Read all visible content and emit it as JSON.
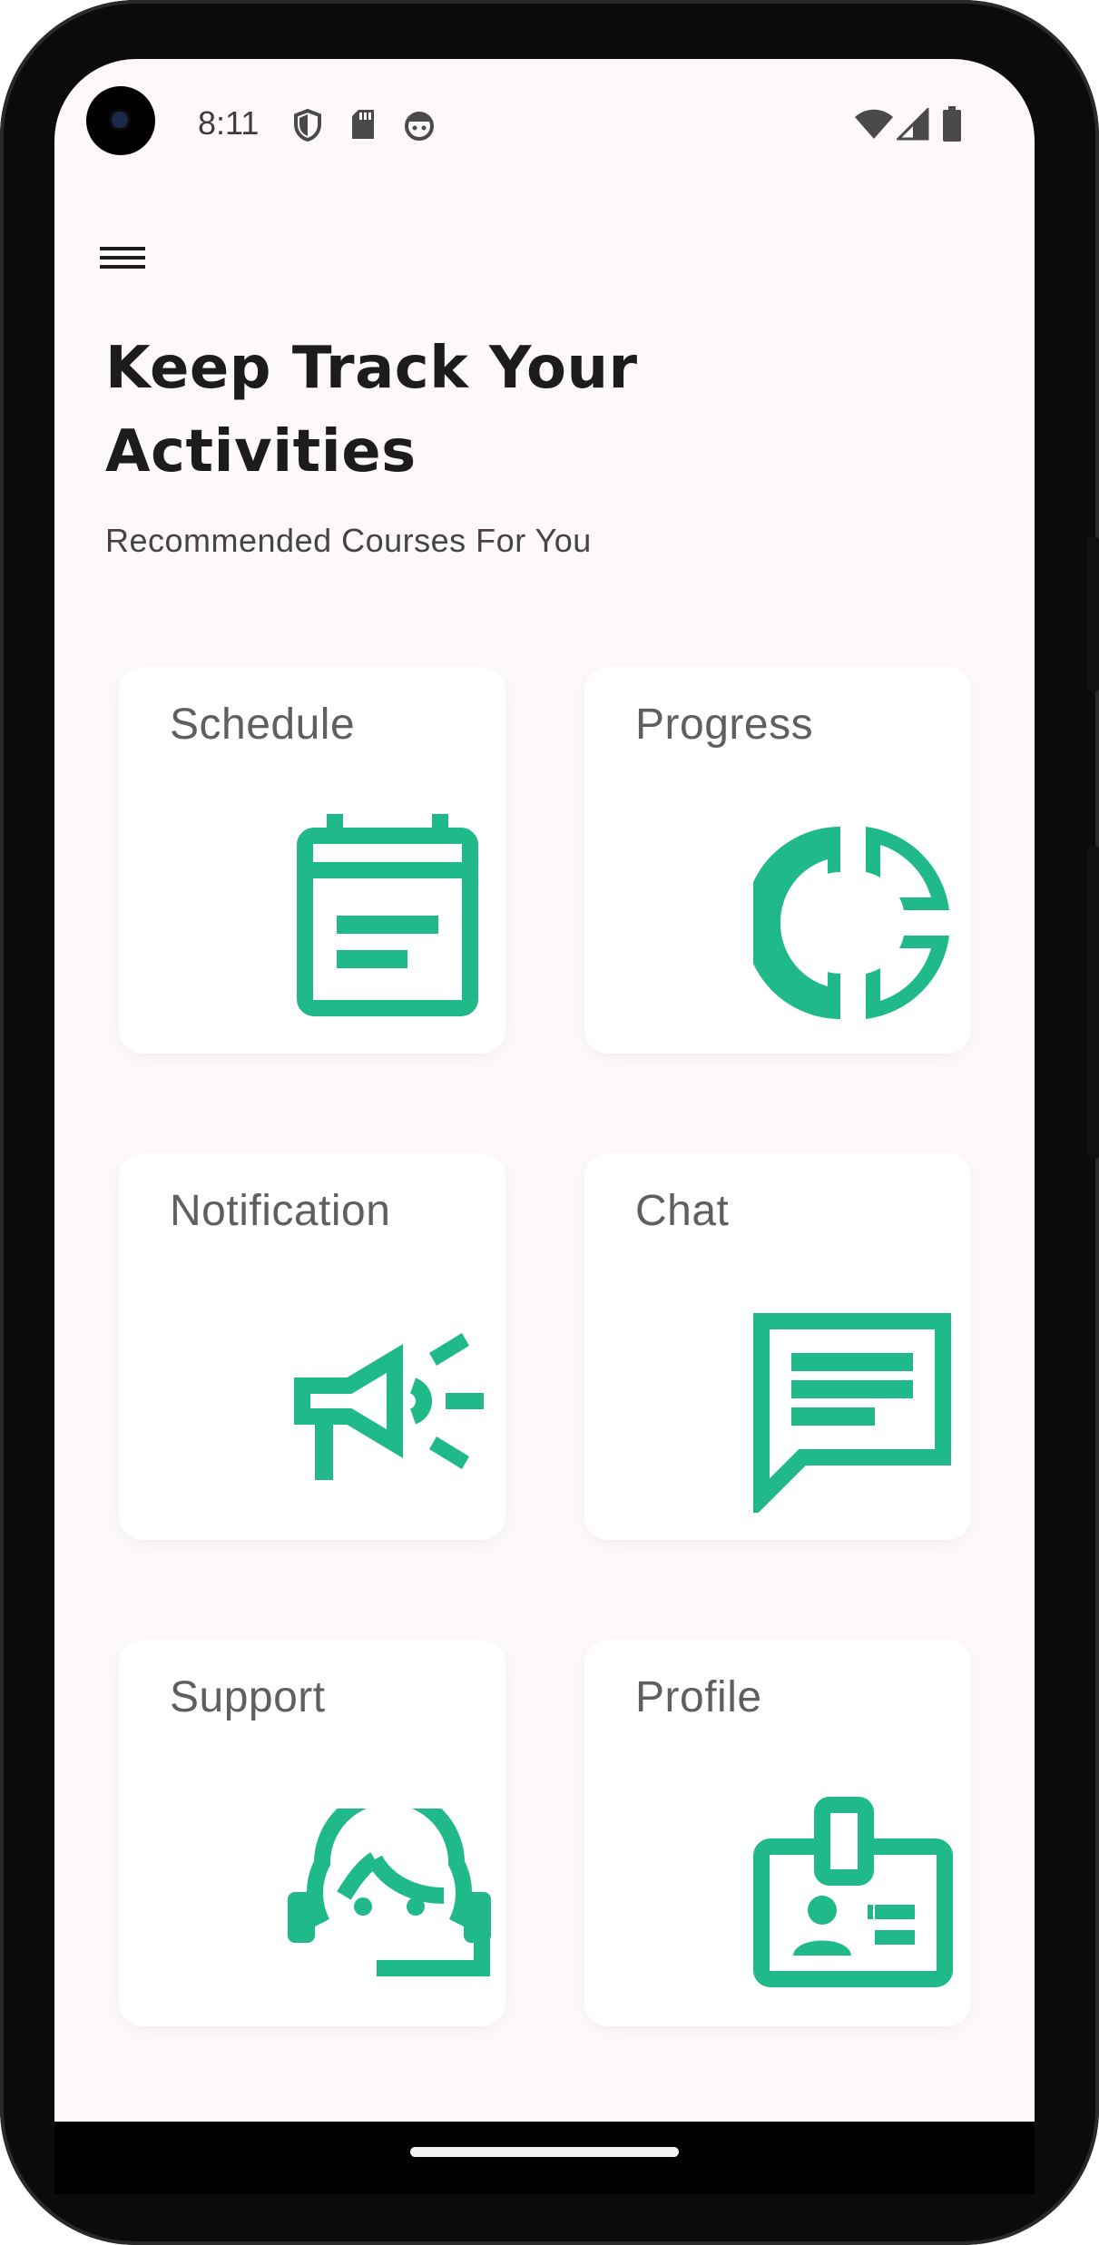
{
  "status": {
    "time": "8:11",
    "icons": [
      "shield-icon",
      "sd-card-icon",
      "android-face-icon",
      "wifi-icon",
      "signal-icon",
      "battery-icon"
    ]
  },
  "header": {
    "menu_icon": "hamburger-menu-icon",
    "title_line1": "Keep Track Your",
    "title_line2": "Activities",
    "subtitle": "Recommended Courses For You"
  },
  "cards": [
    {
      "label": "Schedule",
      "icon": "calendar-icon"
    },
    {
      "label": "Progress",
      "icon": "pie-chart-icon"
    },
    {
      "label": "Notification",
      "icon": "megaphone-icon"
    },
    {
      "label": "Chat",
      "icon": "chat-message-icon"
    },
    {
      "label": "Support",
      "icon": "support-headset-icon"
    },
    {
      "label": "Profile",
      "icon": "id-badge-icon"
    }
  ],
  "colors": {
    "accent": "#20b98a",
    "background": "#fcf8fb",
    "card": "#ffffff",
    "title": "#1c1c1c",
    "label": "#5f5f5f"
  }
}
